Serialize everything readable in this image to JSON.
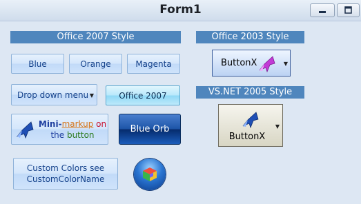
{
  "window": {
    "title": "Form1"
  },
  "sections": {
    "office2007": "Office 2007 Style",
    "office2003": "Office 2003 Style",
    "vsnet2005": "VS.NET 2005 Style"
  },
  "buttons": {
    "blue": "Blue",
    "orange": "Orange",
    "magenta": "Magenta",
    "dropdown": "Drop down menu",
    "office2007": "Office 2007",
    "mini": {
      "part1": "Mini-",
      "part2": "markup",
      "part3": " on",
      "line2_1": "the ",
      "line2_2": "button"
    },
    "blue_orb": "Blue Orb",
    "custom_colors": {
      "line1": "Custom Colors see",
      "line2": "CustomColorName"
    },
    "buttonx_2003": "ButtonX",
    "buttonx_vs": "ButtonX"
  },
  "colors": {
    "section_bg": "#4f86bd",
    "mini_accent_blue": "#1f3f9f",
    "mini_accent_orange": "#d6761b",
    "mini_accent_red": "#c8102e",
    "mini_accent_green": "#2b7a1d"
  },
  "icons": {
    "minimize": "minimize-icon",
    "restore": "restore-icon",
    "wand": "magic-wand-icon",
    "orb": "color-cube-icon"
  }
}
